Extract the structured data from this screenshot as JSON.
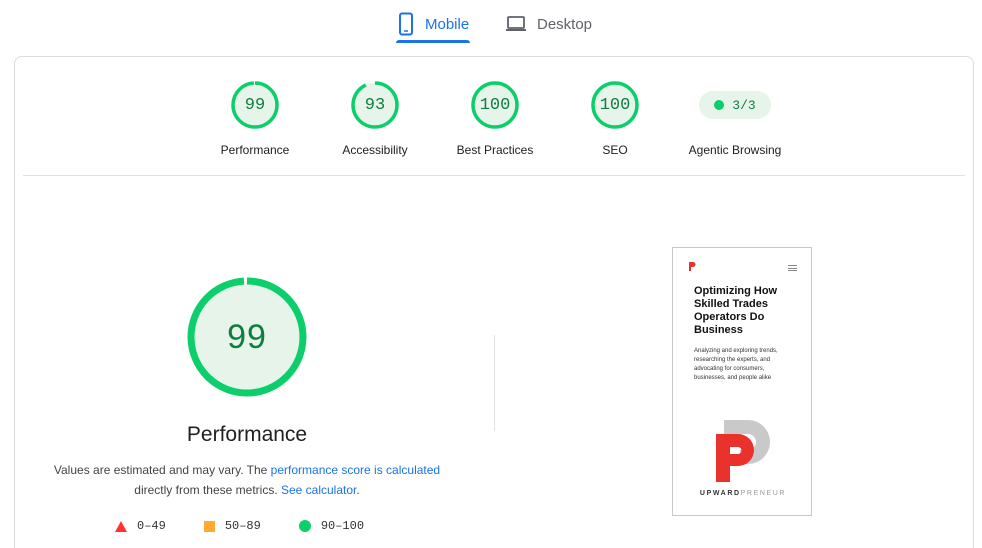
{
  "tabs": {
    "mobile_label": "Mobile",
    "desktop_label": "Desktop",
    "active": "mobile"
  },
  "categories": [
    {
      "label": "Performance",
      "score": "99",
      "fraction": 0.99
    },
    {
      "label": "Accessibility",
      "score": "93",
      "fraction": 0.93
    },
    {
      "label": "Best Practices",
      "score": "100",
      "fraction": 1.0
    },
    {
      "label": "SEO",
      "score": "100",
      "fraction": 1.0
    }
  ],
  "agentic": {
    "label": "Agentic Browsing",
    "value": "3/3"
  },
  "performance": {
    "score": "99",
    "fraction": 0.99,
    "title": "Performance",
    "note_prefix": "Values are estimated and may vary. The ",
    "note_link1": "performance score is calculated",
    "note_middle": " directly from these metrics. ",
    "note_link2": "See calculator",
    "note_suffix": "."
  },
  "legend": {
    "fail": "0–49",
    "average": "50–89",
    "pass": "90–100"
  },
  "thumbnail": {
    "headline": "Optimizing How Skilled Trades Operators Do Business",
    "body": "Analyzing and exploring trends, researching the experts, and advocating for consumers, businesses, and people alike",
    "brand_strong": "UPWARD",
    "brand_light": "PRENEUR"
  },
  "colors": {
    "accent": "#1a73e8",
    "pass": "#0cce6b",
    "pass_text": "#0c7f3f",
    "pass_fill": "#e6f4ea",
    "average": "#ffaa33",
    "fail": "#ff3333",
    "brand_red": "#e8322b"
  }
}
